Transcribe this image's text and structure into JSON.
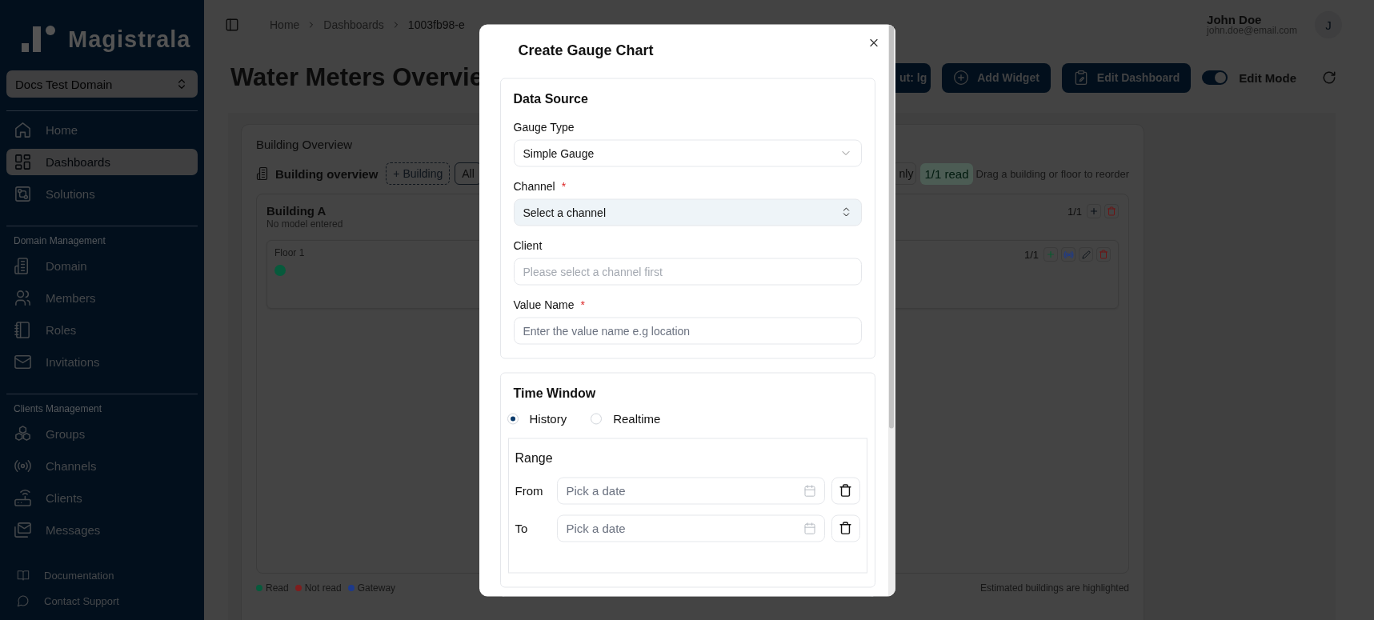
{
  "sidebar": {
    "logo": "Magistrala",
    "domain_selector": "Docs Test Domain",
    "sections": [
      {
        "items": [
          {
            "label": "Home",
            "selected": false
          },
          {
            "label": "Dashboards",
            "selected": true
          },
          {
            "label": "Solutions",
            "selected": false
          }
        ]
      },
      {
        "title": "Domain Management",
        "items": [
          {
            "label": "Domain",
            "selected": false
          },
          {
            "label": "Members",
            "selected": false
          },
          {
            "label": "Roles",
            "selected": false
          },
          {
            "label": "Invitations",
            "selected": false
          }
        ]
      },
      {
        "title": "Clients Management",
        "items": [
          {
            "label": "Groups",
            "selected": false
          },
          {
            "label": "Channels",
            "selected": false
          },
          {
            "label": "Clients",
            "selected": false
          },
          {
            "label": "Messages",
            "selected": false
          }
        ]
      }
    ],
    "footer_links": [
      {
        "label": "Documentation"
      },
      {
        "label": "Contact Support"
      }
    ]
  },
  "header": {
    "breadcrumbs": [
      "Home",
      "Dashboards",
      "1003fb98-e"
    ],
    "user": {
      "name": "John Doe",
      "email": "john.doe@email.com",
      "initial": "J"
    }
  },
  "page": {
    "title": "Water Meters Overvie",
    "toolbar": [
      {
        "label": "ut: lg"
      },
      {
        "label": "Add Widget"
      },
      {
        "label": "Edit Dashboard"
      }
    ],
    "edit_mode": {
      "label": "Edit Mode",
      "on": true
    }
  },
  "widget": {
    "title": "Building Overview",
    "heading": "Building overview",
    "add_building": "+ Building",
    "filters": [
      {
        "label": "All"
      },
      {
        "label": "nly"
      }
    ],
    "read_badge": "1/1 read",
    "hint": "Drag a building or floor to reorder",
    "buildings": [
      {
        "name": "Building A",
        "model": "No model entered",
        "count": "1/1",
        "floors": [
          {
            "name": "Floor 1",
            "count": "1/1",
            "meters": [
              {
                "color": "#075a3c"
              }
            ]
          }
        ]
      }
    ],
    "legend": [
      {
        "label": "Read",
        "color": "#075a3c"
      },
      {
        "label": "Not read",
        "color": "#7f1d1d"
      },
      {
        "label": "Gateway",
        "color": "#1e3a8a"
      }
    ],
    "footer_note": "Estimated buildings are highlighted"
  },
  "dialog": {
    "title": "Create Gauge Chart",
    "data_source": {
      "title": "Data Source",
      "fields": [
        {
          "kind": "select",
          "label": "Gauge Type",
          "value": "Simple Gauge"
        },
        {
          "kind": "combobox",
          "label": "Channel",
          "required_mark": "*",
          "value": "Select a channel"
        },
        {
          "kind": "input",
          "label": "Client",
          "placeholder": "Please select a channel first",
          "disabled": true
        },
        {
          "kind": "input",
          "label": "Value Name",
          "required_mark": "*",
          "placeholder": "Enter the value name e.g location",
          "disabled": false
        }
      ]
    },
    "time_window": {
      "title": "Time Window",
      "options": [
        {
          "label": "History",
          "selected": true
        },
        {
          "label": "Realtime",
          "selected": false
        }
      ],
      "range": {
        "title": "Range",
        "rows": [
          {
            "label": "From",
            "placeholder": "Pick a date"
          },
          {
            "label": "To",
            "placeholder": "Pick a date"
          }
        ]
      }
    }
  }
}
